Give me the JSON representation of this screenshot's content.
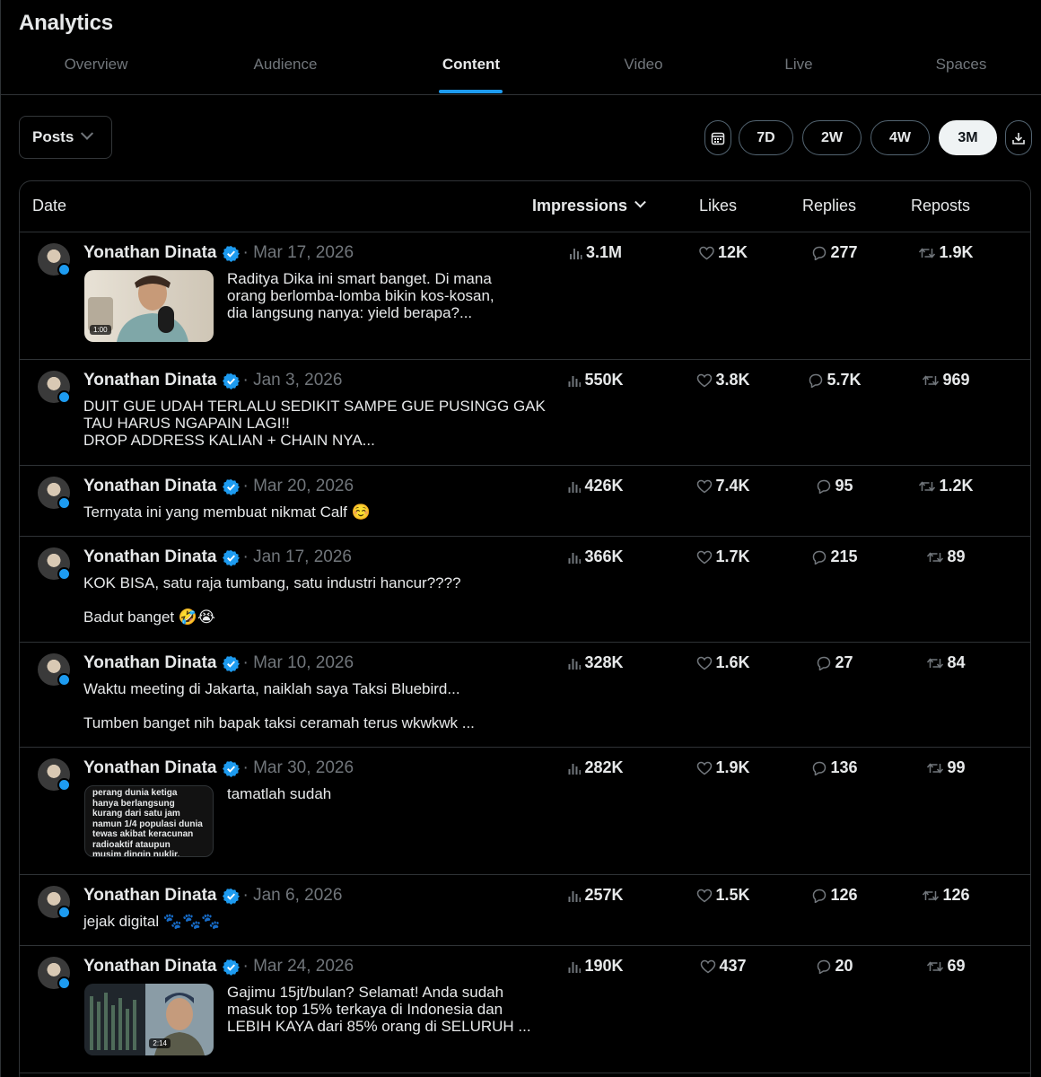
{
  "app": {
    "title": "Analytics"
  },
  "tabs": [
    {
      "label": "Overview",
      "active": false
    },
    {
      "label": "Audience",
      "active": false
    },
    {
      "label": "Content",
      "active": true
    },
    {
      "label": "Video",
      "active": false
    },
    {
      "label": "Live",
      "active": false
    },
    {
      "label": "Spaces",
      "active": false
    }
  ],
  "toolbar": {
    "posts_select": "Posts",
    "ranges": [
      {
        "label": "7D",
        "active": false
      },
      {
        "label": "2W",
        "active": false
      },
      {
        "label": "4W",
        "active": false
      },
      {
        "label": "3M",
        "active": true
      }
    ],
    "calendar_icon": "calendar-icon",
    "download_icon": "download-icon"
  },
  "table": {
    "headers": {
      "date": "Date",
      "impressions": "Impressions",
      "likes": "Likes",
      "replies": "Replies",
      "reposts": "Reposts"
    },
    "sort_by": "Impressions",
    "rows": [
      {
        "author": "Yonathan Dinata",
        "date": "Mar 17, 2026",
        "text": "Raditya Dika ini smart banget. Di mana\norang berlomba-lomba bikin kos-kosan,\ndia langsung nanya: yield berapa?...",
        "thumbnail": "video",
        "thumb_duration": "1:00",
        "impressions": "3.1M",
        "likes": "12K",
        "replies": "277",
        "reposts": "1.9K"
      },
      {
        "author": "Yonathan Dinata",
        "date": "Jan 3, 2026",
        "text": "DUIT GUE UDAH TERLALU SEDIKIT SAMPE GUE PUSINGG GAK\nTAU HARUS NGAPAIN LAGI!!\nDROP ADDRESS KALIAN + CHAIN NYA...",
        "impressions": "550K",
        "likes": "3.8K",
        "replies": "5.7K",
        "reposts": "969"
      },
      {
        "author": "Yonathan Dinata",
        "date": "Mar 20, 2026",
        "text": "Ternyata ini yang membuat nikmat Calf ☺️",
        "impressions": "426K",
        "likes": "7.4K",
        "replies": "95",
        "reposts": "1.2K"
      },
      {
        "author": "Yonathan Dinata",
        "date": "Jan 17, 2026",
        "text": "KOK BISA, satu raja tumbang, satu industri hancur????\n\nBadut banget 🤣😭",
        "impressions": "366K",
        "likes": "1.7K",
        "replies": "215",
        "reposts": "89"
      },
      {
        "author": "Yonathan Dinata",
        "date": "Mar 10, 2026",
        "text": "Waktu meeting di Jakarta, naiklah saya Taksi Bluebird...\n\nTumben banget nih bapak taksi ceramah terus wkwkwk ...",
        "impressions": "328K",
        "likes": "1.6K",
        "replies": "27",
        "reposts": "84"
      },
      {
        "author": "Yonathan Dinata",
        "date": "Mar 30, 2026",
        "text": "tamatlah sudah",
        "thumbnail": "text",
        "thumb_text": "perang dunia ketiga\nhanya berlangsung\nkurang dari satu jam\nnamun 1/4 populasi dunia\ntewas akibat keracunan\nradioaktif ataupun\nmusim dingin nuklir.",
        "impressions": "282K",
        "likes": "1.9K",
        "replies": "136",
        "reposts": "99"
      },
      {
        "author": "Yonathan Dinata",
        "date": "Jan 6, 2026",
        "text": "jejak digital 🐾🐾🐾",
        "impressions": "257K",
        "likes": "1.5K",
        "replies": "126",
        "reposts": "126"
      },
      {
        "author": "Yonathan Dinata",
        "date": "Mar 24, 2026",
        "text": "Gajimu 15jt/bulan? Selamat! Anda sudah\nmasuk top 15% terkaya di Indonesia dan\nLEBIH KAYA dari 85% orang di SELURUH ...",
        "thumbnail": "chart-video",
        "thumb_duration": "2:14",
        "impressions": "190K",
        "likes": "437",
        "replies": "20",
        "reposts": "69"
      }
    ]
  },
  "colors": {
    "background": "#000000",
    "accent": "#1d9bf0",
    "muted": "#71767b",
    "border": "#2f3336",
    "text": "#e7e9ea"
  }
}
